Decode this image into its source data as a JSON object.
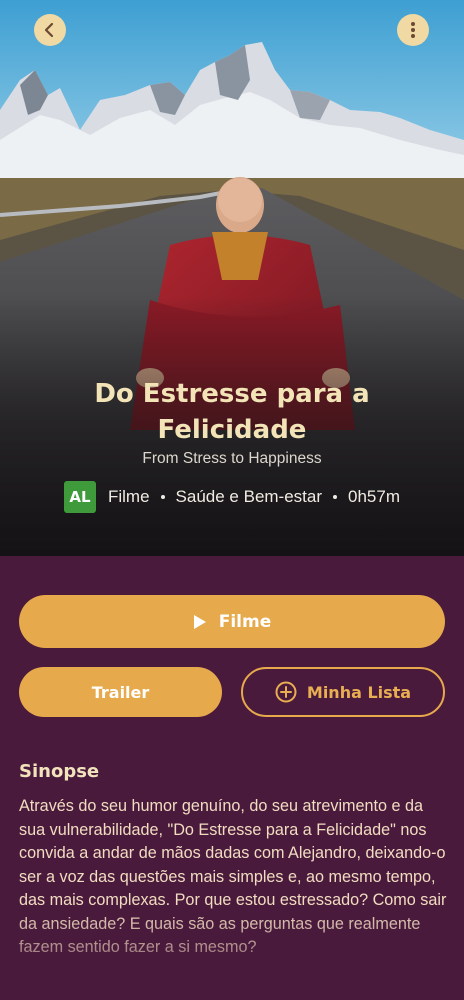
{
  "header": {
    "back_icon": "chevron-left-icon",
    "menu_icon": "more-vertical-icon"
  },
  "movie": {
    "title_line1": "Do Estresse para a",
    "title_line2": "Felicidade",
    "subtitle": "From Stress to Happiness",
    "rating": "AL",
    "rating_color": "#3f9a3c",
    "type": "Filme",
    "category": "Saúde e Bem-estar",
    "duration": "0h57m"
  },
  "actions": {
    "play_label": "Filme",
    "play_icon": "play-icon",
    "trailer_label": "Trailer",
    "list_label": "Minha Lista",
    "list_icon": "plus-circle-icon"
  },
  "synopsis": {
    "heading": "Sinopse",
    "text": "Através do seu humor genuíno, do seu atrevimento e da sua vulnerabilidade, \"Do Estresse para a Felicidade\" nos convida a andar de mãos dadas com Alejandro, deixando-o ser a voz das questões mais simples e, ao mesmo tempo, das mais complexas. Por que estou estressado? Como sair da ansiedade? E quais são as perguntas que realmente fazem sentido fazer a si mesmo?"
  },
  "colors": {
    "background": "#4a1a3c",
    "accent": "#e6a94c",
    "title": "#f3e4b8",
    "button_circle": "#f0d9a2"
  }
}
